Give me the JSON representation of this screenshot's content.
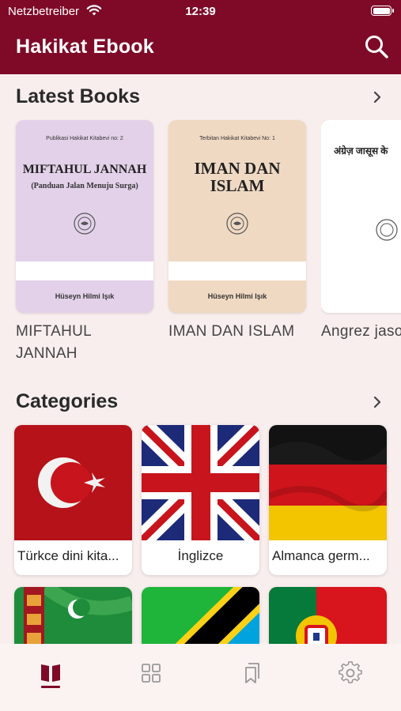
{
  "status_bar": {
    "carrier": "Netzbetreiber",
    "time": "12:39"
  },
  "header": {
    "title": "Hakikat Ebook"
  },
  "sections": {
    "latest": {
      "title": "Latest Books"
    },
    "categories": {
      "title": "Categories"
    }
  },
  "books": [
    {
      "label": "MIFTAHUL JANNAH",
      "cover": {
        "publisher": "Publikasi Hakikat Kitabevi no: 2",
        "title": "MIFTAHUL JANNAH",
        "subtitle": "(Panduan Jalan Menuju Surga)",
        "author": "Hüseyn Hilmi Işık",
        "color": "#e3d1ea"
      }
    },
    {
      "label": "IMAN DAN ISLAM",
      "cover": {
        "publisher": "Terbitan Hakikat Kitabevi No: 1",
        "title": "IMAN DAN ISLAM",
        "author": "Hüseyn Hilmi Işık",
        "color": "#f0d9c3"
      }
    },
    {
      "label": "Angrez jasoos",
      "cover": {
        "title": "अंग्रेज़ जासूस के",
        "color": "#ffffff"
      }
    }
  ],
  "categories": [
    {
      "label": "Türkce dini kita...",
      "flag": "turkey"
    },
    {
      "label": "İnglizce",
      "flag": "uk"
    },
    {
      "label": "Almanca germ...",
      "flag": "germany"
    },
    {
      "label": "",
      "flag": "turkmenistan"
    },
    {
      "label": "",
      "flag": "tanzania"
    },
    {
      "label": "",
      "flag": "portugal"
    }
  ],
  "tabs": [
    {
      "icon": "open-book-icon",
      "active": true
    },
    {
      "icon": "grid-icon",
      "active": false
    },
    {
      "icon": "bookmarks-icon",
      "active": false
    },
    {
      "icon": "gear-icon",
      "active": false
    }
  ],
  "colors": {
    "primary": "#7e0a28",
    "background": "#f9eeee"
  }
}
